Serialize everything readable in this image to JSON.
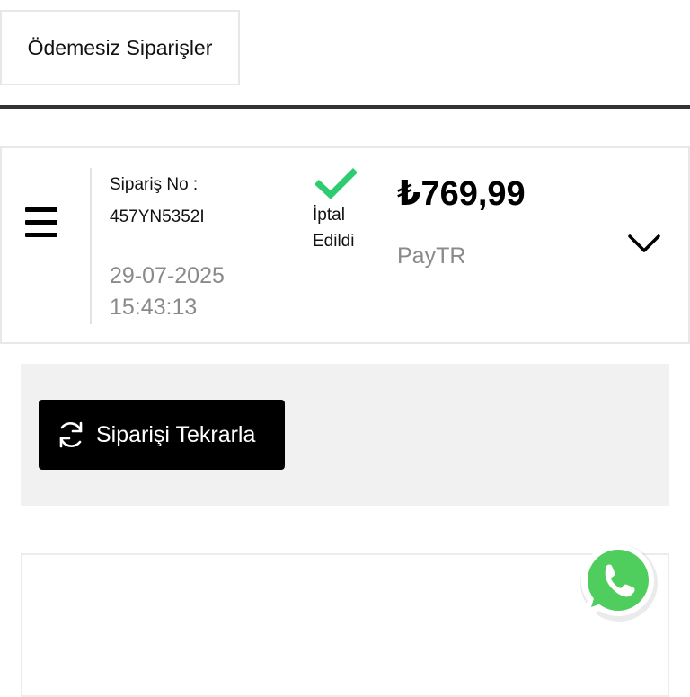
{
  "tabs": {
    "active_label": "Ödemesiz Siparişler"
  },
  "order": {
    "label": "Sipariş No :",
    "number": "457YN5352I",
    "date": "29-07-2025",
    "time": "15:43:13",
    "status_line1": "İptal",
    "status_line2": "Edildi",
    "price": "₺769,99",
    "payment_method": "PayTR"
  },
  "actions": {
    "reorder_label": "Siparişi Tekrarla"
  },
  "icons": {
    "menu": "hamburger-menu-icon",
    "status": "checkmark-icon",
    "expand": "chevron-down-icon",
    "reorder": "refresh-icon",
    "chat": "whatsapp-icon"
  },
  "colors": {
    "status_check": "#2ecc71",
    "whatsapp": "#4fce5d",
    "button_bg": "#000000",
    "divider": "#333333",
    "muted_text": "#8a8a8a",
    "panel_bg": "#f1f1f1"
  }
}
